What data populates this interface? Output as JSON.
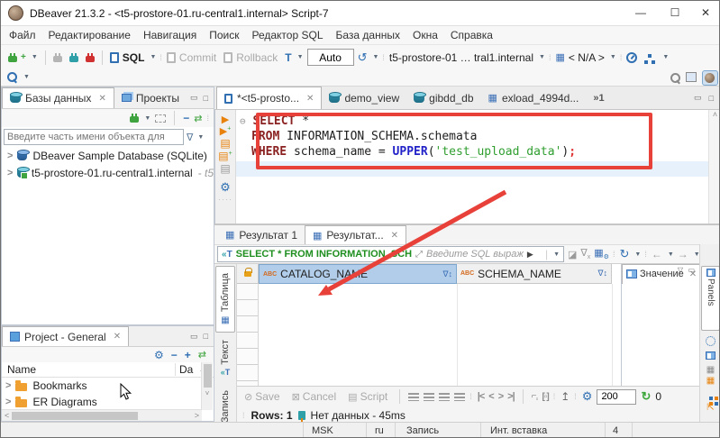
{
  "window": {
    "title": "DBeaver 21.3.2 - <t5-prostore-01.ru-central1.internal> Script-7",
    "minimize": "—",
    "maximize": "☐",
    "close": "✕"
  },
  "menubar": {
    "items": [
      "Файл",
      "Редактирование",
      "Навигация",
      "Поиск",
      "Редактор SQL",
      "База данных",
      "Окна",
      "Справка"
    ]
  },
  "toolbar": {
    "sql": "SQL",
    "commit": "Commit",
    "rollback": "Rollback",
    "auto": "Auto",
    "connection": "t5-prostore-01 … tral1.internal",
    "schema": "< N/A >"
  },
  "database_panel": {
    "tab_databases": "Базы данных",
    "tab_projects": "Проекты",
    "filter_placeholder": "Введите часть имени объекта для ",
    "items": [
      {
        "label": "DBeaver Sample Database (SQLite)",
        "suffix": ""
      },
      {
        "label": "t5-prostore-01.ru-central1.internal",
        "suffix": "- t5"
      }
    ]
  },
  "project_panel": {
    "tab": "Project - General",
    "col_name": "Name",
    "col_date": "Da",
    "items": [
      "Bookmarks",
      "ER Diagrams"
    ]
  },
  "editor": {
    "tab_active": "*<t5-prosto...",
    "tab_demo": "demo_view",
    "tab_gibdd": "gibdd_db",
    "tab_exload": "exload_4994d...",
    "overflow": "»1",
    "sql": {
      "kw_select": "SELECT",
      "select_rest": " *",
      "kw_from": "FROM",
      "from_rest": " INFORMATION_SCHEMA.schemata",
      "kw_where": "WHERE",
      "where_mid": " schema_name = ",
      "fn_upper": "UPPER",
      "open_paren": "(",
      "string_literal": "'test_upload_data'",
      "close_paren": ")",
      "semicolon": ";"
    }
  },
  "results": {
    "tab1": "Результат 1",
    "tab2": "Результат...",
    "filter_query": "SELECT * FROM INFORMATION_SCH",
    "filter_hint": "Введите SQL выраж",
    "tab_table": "Таблица",
    "tab_text": "Текст",
    "record_mode": "Запись",
    "col_type": "ABC",
    "col1": "CATALOG_NAME",
    "col2": "SCHEMA_NAME",
    "value_panel": "Значение",
    "panels": "Panels",
    "save": "Save",
    "cancel": "Cancel",
    "script": "Script",
    "fetch_size": "200",
    "refresh_count": "0",
    "rows_label": "Rows: 1",
    "status_message": "Нет данных - 45ms"
  },
  "statusbar": {
    "timezone": "MSK",
    "locale": "ru",
    "write_mode": "Запись",
    "insert_mode": "Инт. вставка",
    "caret_line": "4"
  },
  "colors": {
    "annotation": "#e8413a",
    "keyword": "#8b2222",
    "function": "#2222c8",
    "string": "#2f9e2f",
    "accent_blue": "#2f6fb2",
    "accent_orange": "#e8820c"
  }
}
